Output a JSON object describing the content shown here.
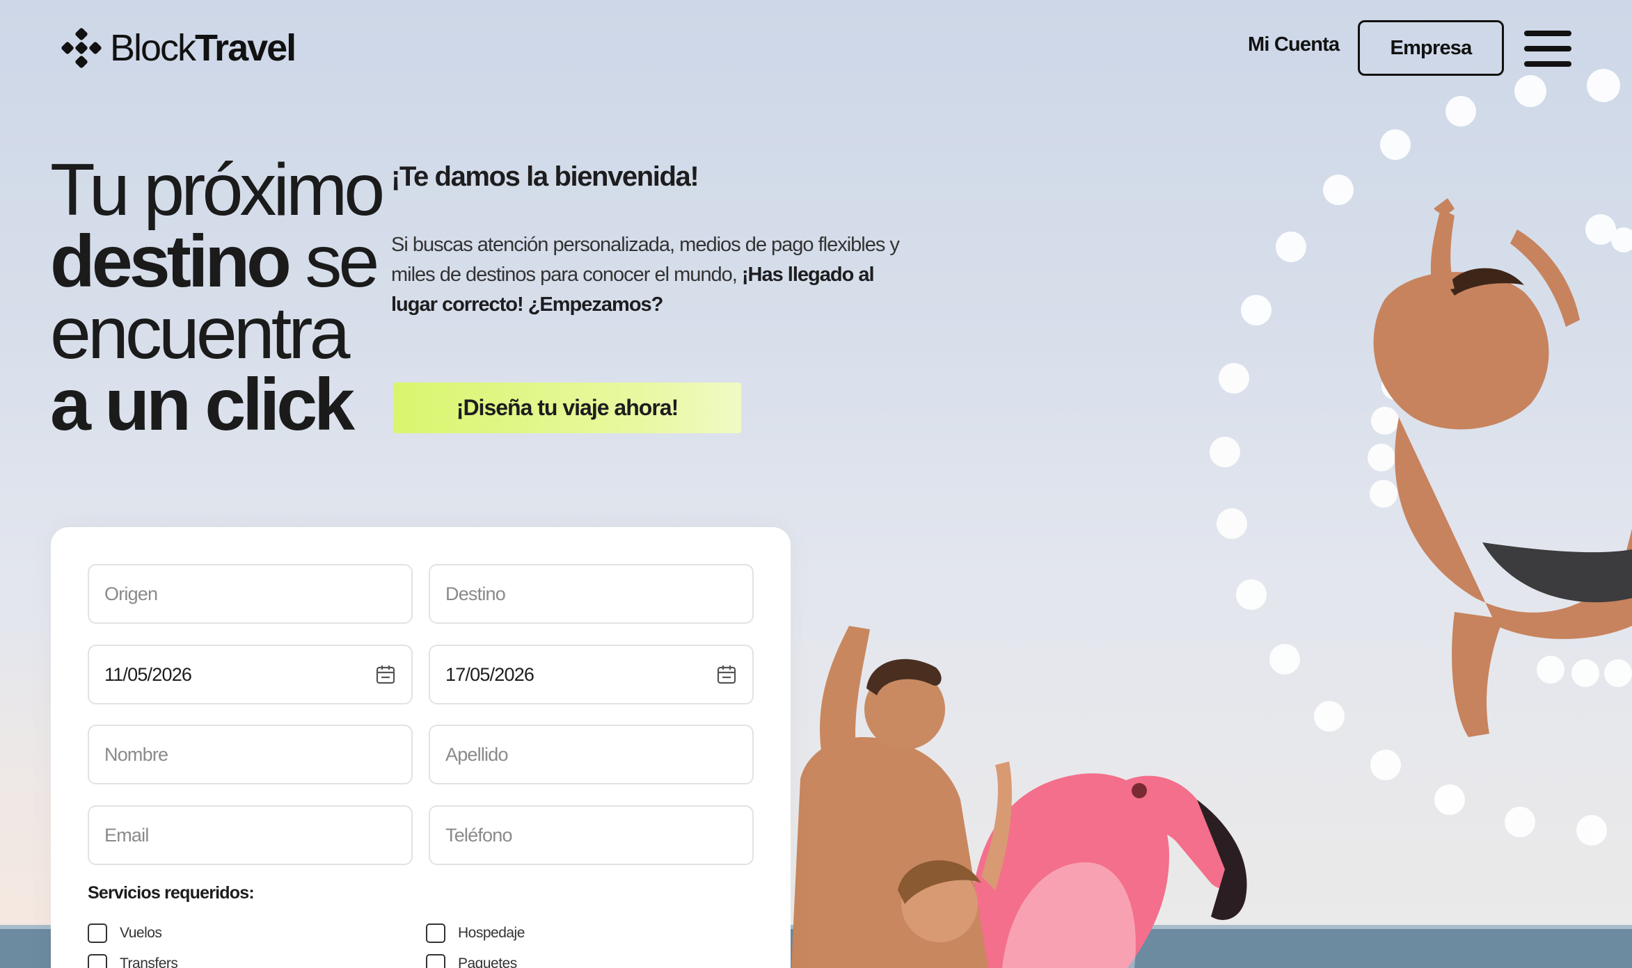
{
  "header": {
    "logo_light": "Block",
    "logo_bold": "Travel",
    "account_label": "Mi Cuenta",
    "business_button": "Empresa",
    "menu_icon": "hamburger-menu-icon"
  },
  "hero": {
    "title_line1": "Tu próximo",
    "title_line2_bold": "destino",
    "title_line2_light": " se",
    "title_line3": "encuentra",
    "title_line4": "a un click",
    "welcome": "¡Te damos la bienvenida!",
    "intro_plain": "Si buscas atención personalizada, medios de pago flexibles y miles de destinos para conocer el mundo, ",
    "intro_bold": "¡Has llegado al lugar correcto! ¿Empezamos?",
    "cta_label": "¡Diseña tu viaje ahora!"
  },
  "form": {
    "origin_placeholder": "Origen",
    "destination_placeholder": "Destino",
    "start_date": "11/05/2026",
    "end_date": "17/05/2026",
    "first_name_placeholder": "Nombre",
    "last_name_placeholder": "Apellido",
    "email_placeholder": "Email",
    "phone_placeholder": "Teléfono",
    "services_label": "Servicios requeridos:",
    "services": [
      "Vuelos",
      "Hospedaje",
      "Transfers",
      "Paquetes"
    ]
  },
  "colors": {
    "accent": "#dcf572",
    "text": "#1d1d1f",
    "flamingo": "#f26a86"
  }
}
